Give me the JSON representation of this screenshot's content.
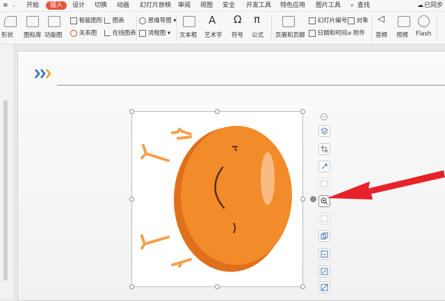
{
  "menu": {
    "tabs": [
      "开始",
      "插入",
      "设计",
      "切换",
      "动画",
      "幻灯片放映",
      "审阅",
      "视图",
      "安全",
      "开发工具",
      "特色应用",
      "图片工具"
    ],
    "active": "插入",
    "search": "查找",
    "sync": "已同步"
  },
  "ribbon": {
    "shape": "形状",
    "icon_lib": "图标库",
    "func_chart": "功能图",
    "smart_graphic": "智能图形",
    "relation_chart": "关系图",
    "chart": "图表",
    "online_chart": "在线图表",
    "mind_map": "思维导图",
    "flow_chart": "流程图",
    "textbox": "文本框",
    "art_text": "艺术字",
    "symbol": "符号",
    "formula": "公式",
    "header_footer": "页眉和页脚",
    "slide_number": "幻灯片编号",
    "date_time": "日期和时间",
    "object": "对象",
    "attachment": "附件",
    "audio": "音频",
    "video": "视频",
    "flash": "Flash"
  },
  "colors": {
    "accent": "#e8553c",
    "character_orange": "#f28b2a",
    "arrow_red": "#e8222a",
    "chevron_blue": "#2f6dc4",
    "chevron_orange": "#f29a2e"
  }
}
